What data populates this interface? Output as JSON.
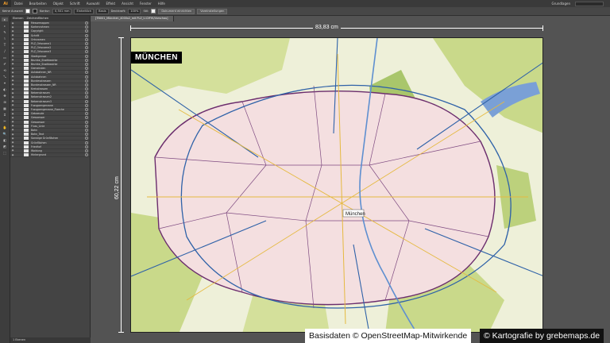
{
  "menubar": {
    "logo": "Ai",
    "items": [
      "Datei",
      "Bearbeiten",
      "Objekt",
      "Schrift",
      "Auswahl",
      "Effekt",
      "Ansicht",
      "Fenster",
      "Hilfe"
    ],
    "workspace": "Grundlagen"
  },
  "controlbar": {
    "selection": "Keine Auswahl",
    "stroke_label": "Kontur:",
    "stroke_value": "0,501 mm",
    "profile": "Einheitlich",
    "brush": "Basis",
    "opacity_label": "Deckkraft:",
    "opacity_value": "100%",
    "style_label": "Stil:",
    "doc_setup": "Dokument einrichten",
    "prefs": "Voreinstellungen"
  },
  "tools": [
    "▸",
    "▹",
    "✎",
    "⌇",
    "T",
    "/",
    "▭",
    "✐",
    "⟲",
    "⤡",
    "⌖",
    "◐",
    "✥",
    "⊞",
    "▦",
    "⌗",
    "✂",
    "✋",
    "🔍",
    "◧",
    "◩",
    "⬚"
  ],
  "layers": {
    "tab": "Ebenen",
    "tab2": "Zeichenflächen",
    "items": [
      "Messemappen",
      "Kartenrahmen",
      "Copyright",
      "Schrift",
      "Ortsnamen",
      "PLZ_Ortsname1",
      "PLZ_Ortsname2",
      "PLZ_Ortsname3",
      "Stadtgrenze",
      "Bezirke_Stadtbezirke",
      "Bezirke_Stadtbezirke",
      "Gemeinden",
      "Autobahnen_NR",
      "Autobahnen",
      "Bundesstrassen",
      "Bundesstrassen_NR",
      "Kreisstrassen",
      "Nebenstrassen",
      "Nebenstrassen2",
      "Nebenstrassen3",
      "Fussgaengerzone",
      "Fussgaengerzone_Flaeche",
      "Gebaeude",
      "Gewaesser",
      "Gewaesser",
      "Fluss_Linie",
      "Bahn",
      "Bahn_Text",
      "Sonstige Grünflächen",
      "Grünflächen",
      "Friedhof",
      "Waldung",
      "Hintergrund"
    ],
    "footer": "1 Ebenen"
  },
  "document_tab": "[TN001_München_4000x2_mit PLZ_U.CMYK/Vorschau]",
  "dimensions": {
    "width": "83,83 cm",
    "height": "60,22 cm"
  },
  "map": {
    "title": "MÜNCHEN",
    "center_label": "München"
  },
  "credits": {
    "left": "Basisdaten © OpenStreetMap-Mitwirkende",
    "right": "© Kartografie by grebemaps.de"
  }
}
